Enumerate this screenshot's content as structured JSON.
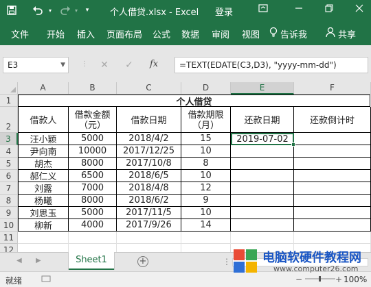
{
  "window": {
    "title": "个人借贷.xlsx  -  Excel",
    "login": "登录"
  },
  "ribbon": {
    "tabs": [
      "文件",
      "开始",
      "插入",
      "页面布局",
      "公式",
      "数据",
      "审阅",
      "视图"
    ],
    "tell_me": "告诉我",
    "share": "共享"
  },
  "formula_bar": {
    "name_box": "E3",
    "fx": "fx",
    "formula": "=TEXT(EDATE(C3,D3), \"yyyy-mm-dd\")"
  },
  "sheet": {
    "columns": [
      "A",
      "B",
      "C",
      "D",
      "E",
      "F"
    ],
    "rows": [
      "1",
      "2",
      "3",
      "4",
      "5",
      "6",
      "7",
      "8",
      "9",
      "10",
      "11",
      "12"
    ],
    "selected_column": "E",
    "selected_row": "3",
    "title": "个人借贷",
    "headers": [
      "借款人",
      "借款金额（元）",
      "借款日期",
      "借款期限（月）",
      "还款日期",
      "还款倒计时"
    ],
    "records": [
      [
        "汪小颖",
        "5000",
        "2018/4/2",
        "15",
        "2019-07-02",
        ""
      ],
      [
        "尹向南",
        "10000",
        "2017/12/25",
        "10",
        "",
        ""
      ],
      [
        "胡杰",
        "8000",
        "2017/10/8",
        "8",
        "",
        ""
      ],
      [
        "郝仁义",
        "6500",
        "2018/6/5",
        "10",
        "",
        ""
      ],
      [
        "刘露",
        "7000",
        "2018/4/8",
        "12",
        "",
        ""
      ],
      [
        "杨曦",
        "8000",
        "2018/6/2",
        "9",
        "",
        ""
      ],
      [
        "刘思玉",
        "5000",
        "2017/11/5",
        "10",
        "",
        ""
      ],
      [
        "柳新",
        "4000",
        "2017/9/26",
        "14",
        "",
        ""
      ]
    ]
  },
  "sheet_tabs": {
    "active": "Sheet1"
  },
  "status": {
    "ready": "就绪",
    "zoom": "100%"
  },
  "watermark": {
    "text": "电脑软硬件教程网",
    "url": "www.computer26.com"
  },
  "colors": {
    "excel_green": "#217346",
    "watermark_blue": "#1a56c4"
  }
}
